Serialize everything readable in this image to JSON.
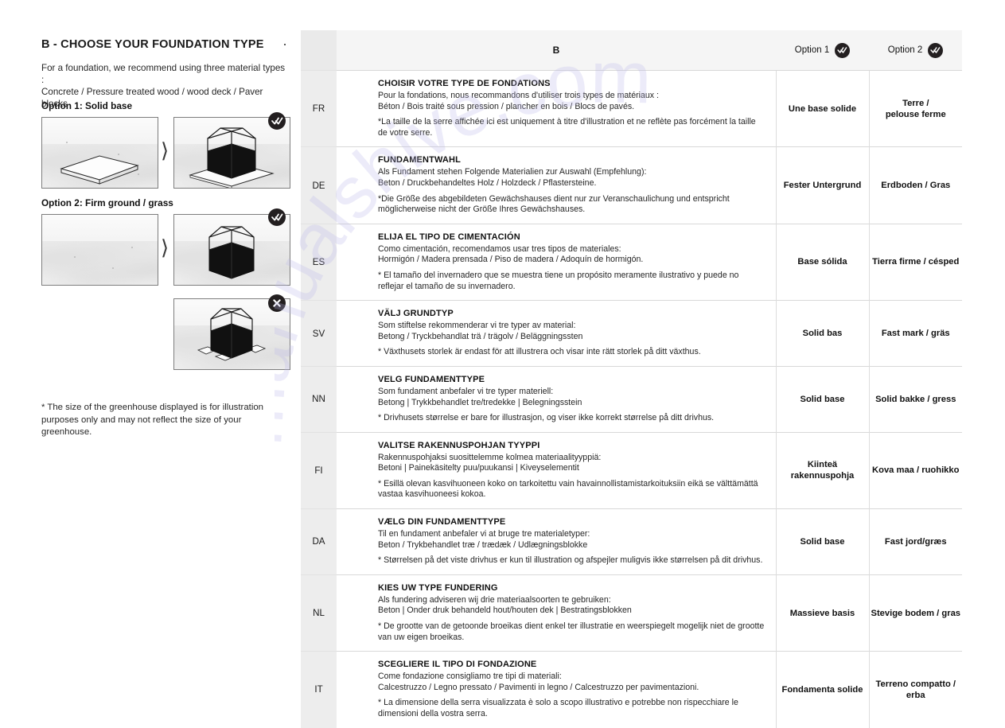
{
  "left": {
    "section_title": "B -  CHOOSE YOUR FOUNDATION TYPE",
    "intro_line1": "For a foundation, we recommend using three material types :",
    "intro_line2": "Concrete / Pressure treated wood / wood deck / Paver blocks",
    "option1_label": "Option 1: Solid base",
    "option2_label": "Option 2: Firm ground / grass",
    "arrow_glyph": "⟩",
    "footnote": "* The size of the greenhouse displayed is for illustration purposes only and may not reflect the size of your greenhouse.",
    "illustrations": [
      {
        "name": "slab-on-ground",
        "badge": "none"
      },
      {
        "name": "greenhouse-on-slab",
        "badge": "check"
      },
      {
        "name": "firm-ground-empty",
        "badge": "none"
      },
      {
        "name": "greenhouse-on-ground",
        "badge": "check"
      },
      {
        "name": "greenhouse-on-pavers-bad",
        "badge": "cross"
      }
    ]
  },
  "table": {
    "header": {
      "lang": "",
      "section": "B",
      "option1": "Option 1",
      "option2": "Option 2",
      "option1_icon": "double-check-icon",
      "option2_icon": "double-check-icon"
    },
    "rows": [
      {
        "lang": "FR",
        "title": "CHOISIR VOTRE TYPE DE FONDATIONS",
        "lines": [
          "Pour la fondations, nous recommandons d'utiliser trois types de matériaux :",
          "Béton / Bois traité sous pression / plancher en bois / Blocs de pavés."
        ],
        "note": "*La taille de la serre affichée ici est uniquement à titre d'illustration et ne reflète pas forcément la taille de votre serre.",
        "option1": "Une base solide",
        "option2": "Terre /\npelouse ferme"
      },
      {
        "lang": "DE",
        "title": "FUNDAMENTWAHL",
        "lines": [
          "Als Fundament stehen Folgende Materialien zur Auswahl (Empfehlung):",
          "Beton / Druckbehandeltes Holz / Holzdeck / Pflastersteine."
        ],
        "note": "*Die Größe des abgebildeten Gewächshauses dient nur zur Veranschaulichung und entspricht möglicherweise nicht der Größe Ihres Gewächshauses.",
        "option1": "Fester Untergrund",
        "option2": "Erdboden / Gras"
      },
      {
        "lang": "ES",
        "title": "ELIJA EL TIPO DE CIMENTACIÓN",
        "lines": [
          "Como cimentación, recomendamos usar tres tipos de materiales:",
          "Hormigón / Madera prensada / Piso de madera / Adoquín de hormigón."
        ],
        "note": "* El tamaño del invernadero que se muestra tiene un propósito meramente ilustrativo y puede no reflejar el tamaño de su invernadero.",
        "option1": "Base sólida",
        "option2": "Tierra firme / césped"
      },
      {
        "lang": "SV",
        "title": "VÄLJ GRUNDTYP",
        "lines": [
          "Som stiftelse rekommenderar vi tre typer av material:",
          "Betong / Tryckbehandlat trä / trägolv / Beläggningssten"
        ],
        "note": "* Växthusets storlek är endast för att illustrera och visar inte rätt storlek på ditt växthus.",
        "option1": "Solid bas",
        "option2": "Fast mark / gräs"
      },
      {
        "lang": "NN",
        "title": "VELG FUNDAMENTTYPE",
        "lines": [
          "Som fundament anbefaler vi tre typer materiell:",
          "Betong | Trykkbehandlet tre/tredekke | Belegningsstein"
        ],
        "note": "* Drivhusets størrelse er bare for illustrasjon, og viser ikke korrekt størrelse på ditt drivhus.",
        "option1": "Solid base",
        "option2": "Solid bakke / gress"
      },
      {
        "lang": "FI",
        "title": "VALITSE RAKENNUSPOHJAN TYYPPI",
        "lines": [
          "Rakennuspohjaksi suosittelemme kolmea materiaalityyppiä:",
          "Betoni |  Painekäsitelty puu/puukansi  |  Kiveyselementit"
        ],
        "note": "* Esillä olevan kasvihuoneen koko on tarkoitettu vain havainnollistamistarkoituksiin eikä se välttämättä vastaa kasvihuoneesi kokoa.",
        "option1": "Kiinteä rakennuspohja",
        "option2": "Kova maa / ruohikko"
      },
      {
        "lang": "DA",
        "title": "VÆLG DIN FUNDAMENTTYPE",
        "lines": [
          "Til en fundament anbefaler vi at bruge tre materialetyper:",
          "Beton / Trykbehandlet træ / trædæk / Udlægningsblokke"
        ],
        "note": "* Størrelsen på det viste drivhus er kun til illustration og afspejler muligvis ikke størrelsen på dit drivhus.",
        "option1": "Solid base",
        "option2": "Fast jord/græs"
      },
      {
        "lang": "NL",
        "title": "KIES UW TYPE FUNDERING",
        "lines": [
          "Als fundering adviseren wij drie materiaalsoorten te gebruiken:",
          "Beton | Onder druk behandeld hout/houten dek | Bestratingsblokken"
        ],
        "note": "* De grootte van de getoonde broeikas dient enkel ter illustratie en weerspiegelt mogelijk niet de grootte van uw eigen broeikas.",
        "option1": "Massieve basis",
        "option2": "Stevige bodem / gras"
      },
      {
        "lang": "IT",
        "title": "SCEGLIERE IL TIPO DI FONDAZIONE",
        "lines": [
          "Come fondazione consigliamo tre tipi di materiali:",
          "Calcestruzzo / Legno pressato / Pavimenti in legno / Calcestruzzo per pavimentazioni."
        ],
        "note": "* La dimensione della serra visualizzata è solo a scopo illustrativo e potrebbe non rispecchiare le dimensioni della vostra serra.",
        "option1": "Fondamenta solide",
        "option2": "Terreno compatto / erba"
      }
    ]
  },
  "watermark": {
    "text": "manualshive.com"
  },
  "colors": {
    "badge_bg": "#231f20",
    "lang_col_bg": "#ededed",
    "header_bg": "#f5f5f5",
    "border": "#d8d8d8"
  }
}
